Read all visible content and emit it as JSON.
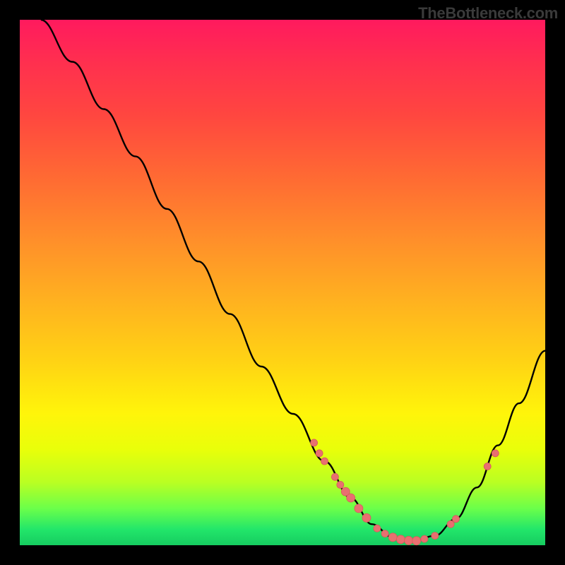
{
  "watermark": "TheBottleneck.com",
  "colors": {
    "curve_stroke": "#000000",
    "marker_fill": "#e87070",
    "marker_stroke": "#d85a5a"
  },
  "chart_data": {
    "type": "line",
    "title": "",
    "xlabel": "",
    "ylabel": "",
    "xlim": [
      0,
      100
    ],
    "ylim": [
      0,
      100
    ],
    "curve": [
      {
        "x": 4,
        "y": 100
      },
      {
        "x": 10,
        "y": 92
      },
      {
        "x": 16,
        "y": 83
      },
      {
        "x": 22,
        "y": 74
      },
      {
        "x": 28,
        "y": 64
      },
      {
        "x": 34,
        "y": 54
      },
      {
        "x": 40,
        "y": 44
      },
      {
        "x": 46,
        "y": 34
      },
      {
        "x": 52,
        "y": 25
      },
      {
        "x": 58,
        "y": 16
      },
      {
        "x": 63,
        "y": 9
      },
      {
        "x": 67,
        "y": 4
      },
      {
        "x": 71,
        "y": 1.5
      },
      {
        "x": 75,
        "y": 0.8
      },
      {
        "x": 79,
        "y": 1.8
      },
      {
        "x": 83,
        "y": 5
      },
      {
        "x": 87,
        "y": 11
      },
      {
        "x": 91,
        "y": 19
      },
      {
        "x": 95,
        "y": 27
      },
      {
        "x": 100,
        "y": 37
      }
    ],
    "markers": [
      {
        "x": 56,
        "y": 19.5,
        "r": 5
      },
      {
        "x": 57,
        "y": 17.5,
        "r": 5
      },
      {
        "x": 58,
        "y": 16,
        "r": 5
      },
      {
        "x": 60,
        "y": 13,
        "r": 5
      },
      {
        "x": 61,
        "y": 11.5,
        "r": 5
      },
      {
        "x": 62,
        "y": 10.2,
        "r": 6
      },
      {
        "x": 63,
        "y": 9,
        "r": 6
      },
      {
        "x": 64.5,
        "y": 7,
        "r": 6
      },
      {
        "x": 66,
        "y": 5.2,
        "r": 6
      },
      {
        "x": 68,
        "y": 3.2,
        "r": 5
      },
      {
        "x": 69.5,
        "y": 2.2,
        "r": 5
      },
      {
        "x": 71,
        "y": 1.5,
        "r": 6
      },
      {
        "x": 72.5,
        "y": 1.1,
        "r": 6
      },
      {
        "x": 74,
        "y": 0.9,
        "r": 6
      },
      {
        "x": 75.5,
        "y": 0.85,
        "r": 6
      },
      {
        "x": 77,
        "y": 1.2,
        "r": 5
      },
      {
        "x": 79,
        "y": 1.8,
        "r": 5
      },
      {
        "x": 82,
        "y": 4,
        "r": 5
      },
      {
        "x": 83,
        "y": 5,
        "r": 5
      },
      {
        "x": 89,
        "y": 15,
        "r": 5
      },
      {
        "x": 90.5,
        "y": 17.5,
        "r": 5
      }
    ]
  }
}
